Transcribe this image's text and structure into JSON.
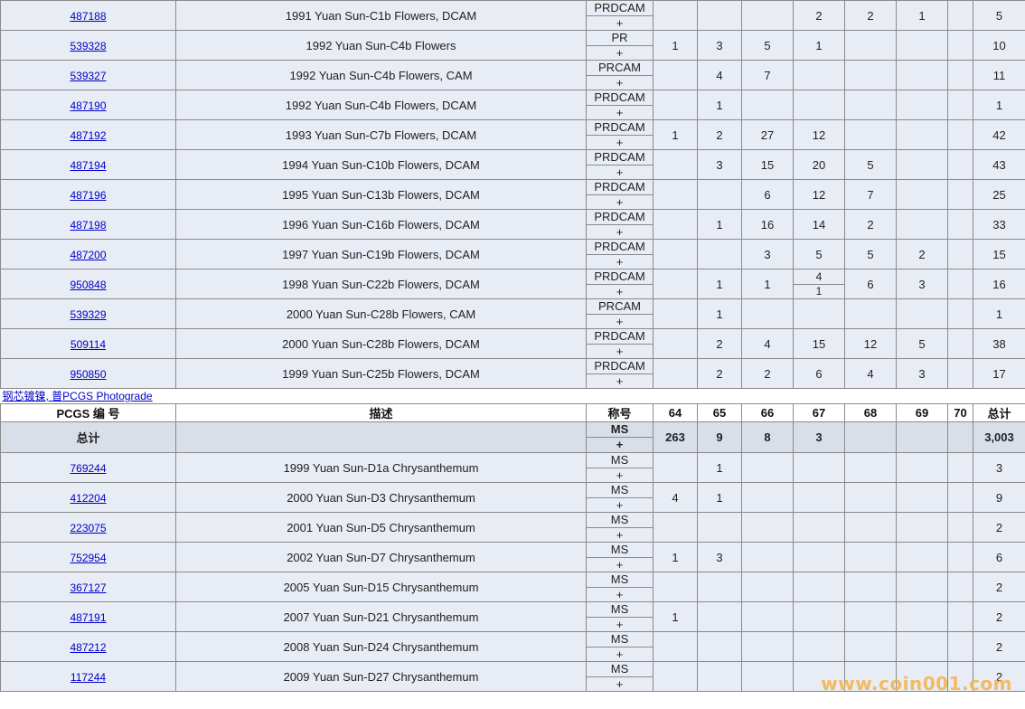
{
  "section1_rows": [
    {
      "id": "487188",
      "desc": "1991 Yuan Sun-C1b Flowers, DCAM",
      "designation": "PRDCAM",
      "plus": "+",
      "g64": "",
      "g65": "",
      "g66": "",
      "g67": "2",
      "g68": "2",
      "g69": "1",
      "g70": "",
      "total": "5"
    },
    {
      "id": "539328",
      "desc": "1992 Yuan Sun-C4b Flowers",
      "designation": "PR",
      "plus": "+",
      "g64": "1",
      "g65": "3",
      "g66": "5",
      "g67": "1",
      "g68": "",
      "g69": "",
      "g70": "",
      "total": "10"
    },
    {
      "id": "539327",
      "desc": "1992 Yuan Sun-C4b Flowers, CAM",
      "designation": "PRCAM",
      "plus": "+",
      "g64": "",
      "g65": "4",
      "g66": "7",
      "g67": "",
      "g68": "",
      "g69": "",
      "g70": "",
      "total": "11"
    },
    {
      "id": "487190",
      "desc": "1992 Yuan Sun-C4b Flowers, DCAM",
      "designation": "PRDCAM",
      "plus": "+",
      "g64": "",
      "g65": "1",
      "g66": "",
      "g67": "",
      "g68": "",
      "g69": "",
      "g70": "",
      "total": "1"
    },
    {
      "id": "487192",
      "desc": "1993 Yuan Sun-C7b Flowers, DCAM",
      "designation": "PRDCAM",
      "plus": "+",
      "g64": "1",
      "g65": "2",
      "g66": "27",
      "g67": "12",
      "g68": "",
      "g69": "",
      "g70": "",
      "total": "42"
    },
    {
      "id": "487194",
      "desc": "1994 Yuan Sun-C10b Flowers, DCAM",
      "designation": "PRDCAM",
      "plus": "+",
      "g64": "",
      "g65": "3",
      "g66": "15",
      "g67": "20",
      "g68": "5",
      "g69": "",
      "g70": "",
      "total": "43"
    },
    {
      "id": "487196",
      "desc": "1995 Yuan Sun-C13b Flowers, DCAM",
      "designation": "PRDCAM",
      "plus": "+",
      "g64": "",
      "g65": "",
      "g66": "6",
      "g67": "12",
      "g68": "7",
      "g69": "",
      "g70": "",
      "total": "25"
    },
    {
      "id": "487198",
      "desc": "1996 Yuan Sun-C16b Flowers, DCAM",
      "designation": "PRDCAM",
      "plus": "+",
      "g64": "",
      "g65": "1",
      "g66": "16",
      "g67": "14",
      "g68": "2",
      "g69": "",
      "g70": "",
      "total": "33"
    },
    {
      "id": "487200",
      "desc": "1997 Yuan Sun-C19b Flowers, DCAM",
      "designation": "PRDCAM",
      "plus": "+",
      "g64": "",
      "g65": "",
      "g66": "3",
      "g67": "5",
      "g68": "5",
      "g69": "2",
      "g70": "",
      "total": "15"
    },
    {
      "id": "950848",
      "desc": "1998 Yuan Sun-C22b Flowers, DCAM",
      "designation": "PRDCAM",
      "plus": "+",
      "g64": "",
      "g65": "1",
      "g66": "1",
      "g67": "4",
      "g67_plus": "1",
      "g68": "6",
      "g69": "3",
      "g70": "",
      "total": "16"
    },
    {
      "id": "539329",
      "desc": "2000 Yuan Sun-C28b Flowers, CAM",
      "designation": "PRCAM",
      "plus": "+",
      "g64": "",
      "g65": "1",
      "g66": "",
      "g67": "",
      "g68": "",
      "g69": "",
      "g70": "",
      "total": "1"
    },
    {
      "id": "509114",
      "desc": "2000 Yuan Sun-C28b Flowers, DCAM",
      "designation": "PRDCAM",
      "plus": "+",
      "g64": "",
      "g65": "2",
      "g66": "4",
      "g67": "15",
      "g68": "12",
      "g69": "5",
      "g70": "",
      "total": "38"
    },
    {
      "id": "950850",
      "desc": "1999 Yuan Sun-C25b Flowers, DCAM",
      "designation": "PRDCAM",
      "plus": "+",
      "g64": "",
      "g65": "2",
      "g66": "2",
      "g67": "6",
      "g68": "4",
      "g69": "3",
      "g70": "",
      "total": "17"
    }
  ],
  "subheading": "钢芯镀镍, 普PCGS Photograde",
  "header": {
    "id": "PCGS 编 号",
    "desc": "描述",
    "designation": "称号",
    "g64": "64",
    "g65": "65",
    "g66": "66",
    "g67": "67",
    "g68": "68",
    "g69": "69",
    "g70": "70",
    "total": "总计"
  },
  "totals": {
    "label": "总计",
    "designation": "MS",
    "plus": "+",
    "g64": "263",
    "g65": "9",
    "g66": "8",
    "g67": "3",
    "g68": "",
    "g69": "",
    "g70": "",
    "total": "3,003"
  },
  "section2_rows": [
    {
      "id": "769244",
      "desc": "1999 Yuan Sun-D1a Chrysanthemum",
      "designation": "MS",
      "plus": "+",
      "g64": "",
      "g65": "1",
      "g66": "",
      "g67": "",
      "g68": "",
      "g69": "",
      "g70": "",
      "total": "3"
    },
    {
      "id": "412204",
      "desc": "2000 Yuan Sun-D3 Chrysanthemum",
      "designation": "MS",
      "plus": "+",
      "g64": "4",
      "g65": "1",
      "g66": "",
      "g67": "",
      "g68": "",
      "g69": "",
      "g70": "",
      "total": "9"
    },
    {
      "id": "223075",
      "desc": "2001 Yuan Sun-D5 Chrysanthemum",
      "designation": "MS",
      "plus": "+",
      "g64": "",
      "g65": "",
      "g66": "",
      "g67": "",
      "g68": "",
      "g69": "",
      "g70": "",
      "total": "2"
    },
    {
      "id": "752954",
      "desc": "2002 Yuan Sun-D7 Chrysanthemum",
      "designation": "MS",
      "plus": "+",
      "g64": "1",
      "g65": "3",
      "g66": "",
      "g67": "",
      "g68": "",
      "g69": "",
      "g70": "",
      "total": "6"
    },
    {
      "id": "367127",
      "desc": "2005 Yuan Sun-D15 Chrysanthemum",
      "designation": "MS",
      "plus": "+",
      "g64": "",
      "g65": "",
      "g66": "",
      "g67": "",
      "g68": "",
      "g69": "",
      "g70": "",
      "total": "2"
    },
    {
      "id": "487191",
      "desc": "2007 Yuan Sun-D21 Chrysanthemum",
      "designation": "MS",
      "plus": "+",
      "g64": "1",
      "g65": "",
      "g66": "",
      "g67": "",
      "g68": "",
      "g69": "",
      "g70": "",
      "total": "2"
    },
    {
      "id": "487212",
      "desc": "2008 Yuan Sun-D24 Chrysanthemum",
      "designation": "MS",
      "plus": "+",
      "g64": "",
      "g65": "",
      "g66": "",
      "g67": "",
      "g68": "",
      "g69": "",
      "g70": "",
      "total": "2"
    },
    {
      "id": "117244",
      "desc": "2009 Yuan Sun-D27 Chrysanthemum",
      "designation": "MS",
      "plus": "+",
      "g64": "",
      "g65": "",
      "g66": "",
      "g67": "",
      "g68": "",
      "g69": "",
      "g70": "",
      "total": "2"
    }
  ],
  "watermark": "www.coin001.com"
}
